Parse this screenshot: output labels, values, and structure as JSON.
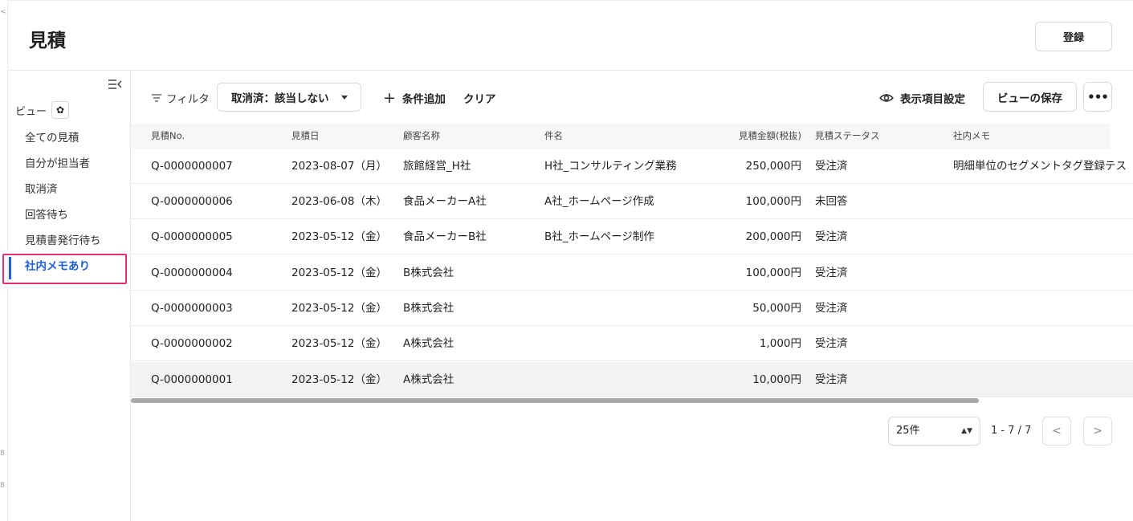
{
  "page": {
    "title": "見積",
    "register_label": "登録"
  },
  "sidebar": {
    "view_label": "ビュー",
    "items": [
      {
        "label": "全ての見積"
      },
      {
        "label": "自分が担当者"
      },
      {
        "label": "取消済"
      },
      {
        "label": "回答待ち"
      },
      {
        "label": "見積書発行待ち"
      },
      {
        "label": "社内メモあり",
        "active": true
      }
    ]
  },
  "toolbar": {
    "filter_label": "フィルタ",
    "filter_chip": "取消済：該当しない",
    "add_condition": "条件追加",
    "clear": "クリア",
    "display_settings": "表示項目設定",
    "save_view": "ビューの保存",
    "more": "•••"
  },
  "table": {
    "columns": [
      "見積No.",
      "見積日",
      "顧客名称",
      "件名",
      "見積金額(税抜)",
      "見積ステータス",
      "社内メモ"
    ],
    "rows": [
      {
        "no": "Q-0000000007",
        "date": "2023-08-07（月）",
        "customer": "旅館経営_H社",
        "subject": "H社_コンサルティング業務",
        "amount": "250,000円",
        "status": "受注済",
        "memo": "明細単位のセグメントタグ登録テス"
      },
      {
        "no": "Q-0000000006",
        "date": "2023-06-08（木）",
        "customer": "食品メーカーA社",
        "subject": "A社_ホームページ作成",
        "amount": "100,000円",
        "status": "未回答",
        "memo": ""
      },
      {
        "no": "Q-0000000005",
        "date": "2023-05-12（金）",
        "customer": "食品メーカーB社",
        "subject": "B社_ホームページ制作",
        "amount": "200,000円",
        "status": "受注済",
        "memo": ""
      },
      {
        "no": "Q-0000000004",
        "date": "2023-05-12（金）",
        "customer": "B株式会社",
        "subject": "",
        "amount": "100,000円",
        "status": "受注済",
        "memo": ""
      },
      {
        "no": "Q-0000000003",
        "date": "2023-05-12（金）",
        "customer": "B株式会社",
        "subject": "",
        "amount": "50,000円",
        "status": "受注済",
        "memo": ""
      },
      {
        "no": "Q-0000000002",
        "date": "2023-05-12（金）",
        "customer": "A株式会社",
        "subject": "",
        "amount": "1,000円",
        "status": "受注済",
        "memo": ""
      },
      {
        "no": "Q-0000000001",
        "date": "2023-05-12（金）",
        "customer": "A株式会社",
        "subject": "",
        "amount": "10,000円",
        "status": "受注済",
        "memo": ""
      }
    ]
  },
  "pagination": {
    "page_size": "25件",
    "range": "1 - 7 / 7",
    "prev": "<",
    "next": ">"
  },
  "colors": {
    "accent": "#1f5fd6",
    "highlight": "#e8326a"
  }
}
